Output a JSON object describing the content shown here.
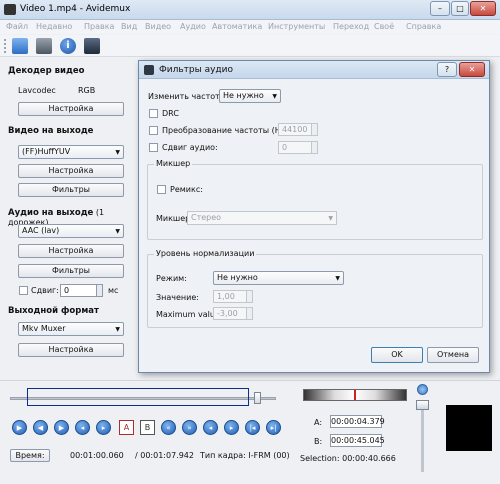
{
  "window": {
    "title": "Video 1.mp4 - Avidemux",
    "minimize": "–",
    "maximize": "□",
    "close": "✕"
  },
  "menu": [
    "Файл",
    "Недавно",
    "Правка",
    "Вид",
    "Видео",
    "Аудио",
    "Автоматика",
    "Инструменты",
    "Переход",
    "Своё",
    "Справка"
  ],
  "toolbar_icons": [
    "open-folder-icon",
    "save-icon",
    "info-icon",
    "film-icon"
  ],
  "left": {
    "video_decoder": {
      "title": "Декодер видео",
      "decoder": "Lavcodec",
      "colorspace": "RGB",
      "settings": "Настройка"
    },
    "video_output": {
      "title": "Видео на выходе",
      "codec": "(FF)HuffYUV",
      "settings": "Настройка",
      "filters": "Фильтры"
    },
    "audio_output": {
      "title": "Аудио на выходе",
      "tracks": "(1 дорожек)",
      "codec": "AAC (lav)",
      "settings": "Настройка",
      "filters": "Фильтры",
      "shift_label": "Сдвиг:",
      "shift_value": "0",
      "shift_unit": "мс"
    },
    "output_format": {
      "title": "Выходной формат",
      "muxer": "Mkv Muxer",
      "settings": "Настройка"
    }
  },
  "dialog": {
    "title": "Фильтры аудио",
    "help": "?",
    "close": "✕",
    "change_rate_label": "Изменить частоту:",
    "change_rate_value": "Не нужно",
    "drc": "DRC",
    "rate_conv_label": "Преобразование частоты (Hz):",
    "rate_conv_value": "44100",
    "audio_shift_label": "Сдвиг аудио:",
    "audio_shift_value": "0",
    "mixer_group": "Микшер",
    "remix": "Ремикс:",
    "mixer_label": "Микшер",
    "mixer_value": "Стерео",
    "norm_group": "Уровень нормализации",
    "mode_label": "Режим:",
    "mode_value": "Не нужно",
    "value_label": "Значение:",
    "value_value": "1,00",
    "max_label": "Maximum value:",
    "max_value": "-3,00",
    "ok": "OK",
    "cancel": "Отмена"
  },
  "bottom": {
    "time_button": "Время:",
    "current_time": "00:01:00.060",
    "total_time": "/ 00:01:07.942",
    "frame_type": "Тип кадра:  I-FRM (00)",
    "a_label": "A:",
    "a_value": "00:00:04.379",
    "b_label": "B:",
    "b_value": "00:00:45.045",
    "selection": "Selection: 00:00:40.666",
    "nav_icons": [
      "play-icon",
      "rewind-icon",
      "forward-icon",
      "prev-frame-icon",
      "next-frame-icon",
      "prev-keyframe-icon",
      "next-keyframe-icon",
      "mark-a-icon",
      "mark-b-icon",
      "prev-black-icon",
      "next-black-icon",
      "goto-start-icon",
      "goto-end-icon",
      "zoom-in-icon",
      "zoom-out-icon",
      "goto-a-icon",
      "goto-b-icon"
    ]
  }
}
